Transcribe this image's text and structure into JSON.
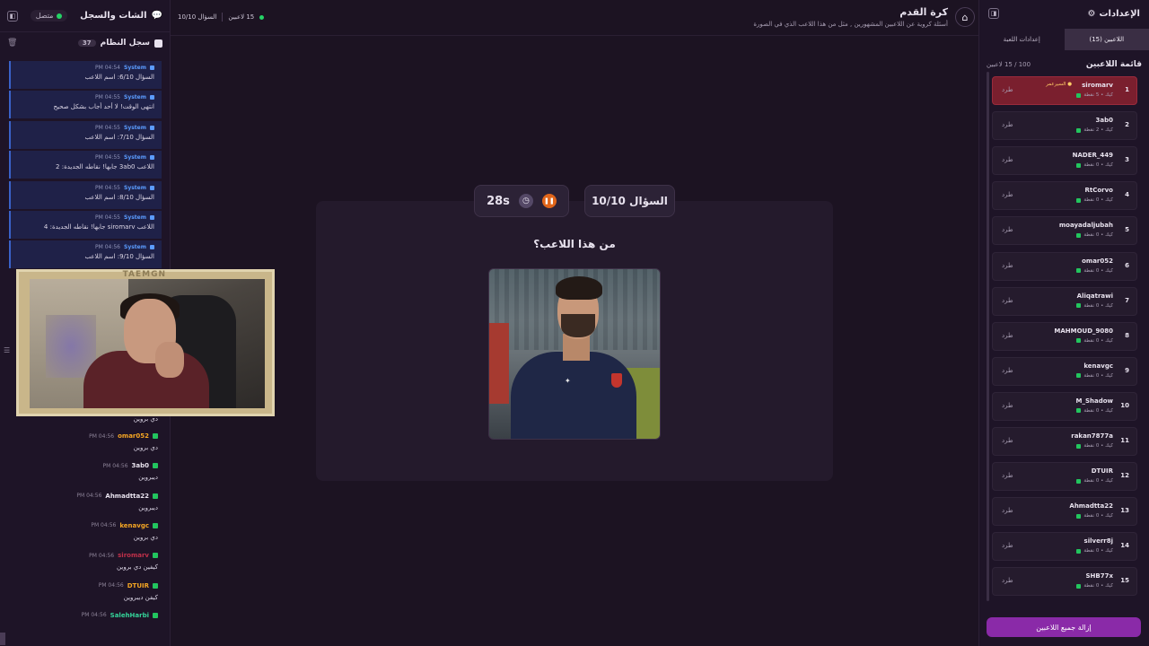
{
  "chat": {
    "title": "الشات والسجل",
    "status": "متصل",
    "system_log_title": "سجل النظام",
    "system_log_count": "37",
    "system_messages": [
      {
        "sender": "System",
        "time": "PM 04:54",
        "text": "السؤال 6/10: اسم اللاعب"
      },
      {
        "sender": "System",
        "time": "PM 04:55",
        "text": "انتهى الوقت! لا أحد أجاب بشكل صحيح"
      },
      {
        "sender": "System",
        "time": "PM 04:55",
        "text": "السؤال 7/10: اسم اللاعب"
      },
      {
        "sender": "System",
        "time": "PM 04:55",
        "text": "اللاعب 3ab0 جابها! نقاطه الجديدة: 2"
      },
      {
        "sender": "System",
        "time": "PM 04:55",
        "text": "السؤال 8/10: اسم اللاعب"
      },
      {
        "sender": "System",
        "time": "PM 04:55",
        "text": "اللاعب siromarv جابها! نقاطه الجديدة: 4"
      },
      {
        "sender": "System",
        "time": "PM 04:56",
        "text": "السؤال 9/10: اسم اللاعب"
      }
    ],
    "user_messages": [
      {
        "user": "",
        "time": "",
        "text": "دي بروين",
        "color": "#e8e2ee"
      },
      {
        "user": "omar052",
        "time": "PM 04:56",
        "text": "دي بروين",
        "color": "#f5a623"
      },
      {
        "user": "3ab0",
        "time": "PM 04:56",
        "text": "ديبروين",
        "color": "#e8e2ee"
      },
      {
        "user": "Ahmadtta22",
        "time": "PM 04:56",
        "text": "ديبروين",
        "color": "#e8e2ee"
      },
      {
        "user": "kenavgc",
        "time": "PM 04:56",
        "text": "دي بروين",
        "color": "#f5a623"
      },
      {
        "user": "siromarv",
        "time": "PM 04:56",
        "text": "كيفين دي بروين",
        "color": "#c0304a"
      },
      {
        "user": "DTUIR",
        "time": "PM 04:56",
        "text": "كيفن ديبروين",
        "color": "#f5a623"
      },
      {
        "user": "SalehHarbi",
        "time": "PM 04:56",
        "text": "",
        "color": "#34d399"
      }
    ]
  },
  "cam": {
    "label": "TAEMGN"
  },
  "header": {
    "title": "كرة القدم",
    "subtitle": "أسئلة كروية عن اللاعبين المشهورين , مثل من هذا اللاعب الذي في الصورة",
    "players_count": "15 لاعبين",
    "question_progress": "السؤال 10/10"
  },
  "quiz": {
    "question_label": "السؤال 10/10",
    "timer": "28s",
    "question": "من هذا اللاعب؟",
    "pause_icon": "pause-icon",
    "clock_icon": "clock-icon"
  },
  "settings": {
    "title": "الإعدادات",
    "tab_players": "اللاعبين (15)",
    "tab_game": "إعدادات اللعبة",
    "list_title": "قائمة اللاعبين",
    "list_count": "100 / 15 لاعبين",
    "kick_label": "طرد",
    "remove_all": "إزالة جميع اللاعبين",
    "players": [
      {
        "rank": "1",
        "name": "siromarv",
        "tag": "● السيرعمر",
        "points": "كيك • 5 نقطة"
      },
      {
        "rank": "2",
        "name": "3ab0",
        "tag": "",
        "points": "كيك • 2 نقطة"
      },
      {
        "rank": "3",
        "name": "NADER_449",
        "tag": "",
        "points": "كيك • 0 نقطة"
      },
      {
        "rank": "4",
        "name": "RtCorvo",
        "tag": "",
        "points": "كيك • 0 نقطة"
      },
      {
        "rank": "5",
        "name": "moayadaljubah",
        "tag": "",
        "points": "كيك • 0 نقطة"
      },
      {
        "rank": "6",
        "name": "omar052",
        "tag": "",
        "points": "كيك • 0 نقطة"
      },
      {
        "rank": "7",
        "name": "Aliqatrawi",
        "tag": "",
        "points": "كيك • 0 نقطة"
      },
      {
        "rank": "8",
        "name": "MAHMOUD_9080",
        "tag": "",
        "points": "كيك • 0 نقطة"
      },
      {
        "rank": "9",
        "name": "kenavgc",
        "tag": "",
        "points": "كيك • 0 نقطة"
      },
      {
        "rank": "10",
        "name": "M_Shadow",
        "tag": "",
        "points": "كيك • 0 نقطة"
      },
      {
        "rank": "11",
        "name": "rakan7877a",
        "tag": "",
        "points": "كيك • 0 نقطة"
      },
      {
        "rank": "12",
        "name": "DTUIR",
        "tag": "",
        "points": "كيك • 0 نقطة"
      },
      {
        "rank": "13",
        "name": "Ahmadtta22",
        "tag": "",
        "points": "كيك • 0 نقطة"
      },
      {
        "rank": "14",
        "name": "silverr8j",
        "tag": "",
        "points": "كيك • 0 نقطة"
      },
      {
        "rank": "15",
        "name": "SHB77x",
        "tag": "",
        "points": "كيك • 0 نقطة"
      }
    ]
  }
}
